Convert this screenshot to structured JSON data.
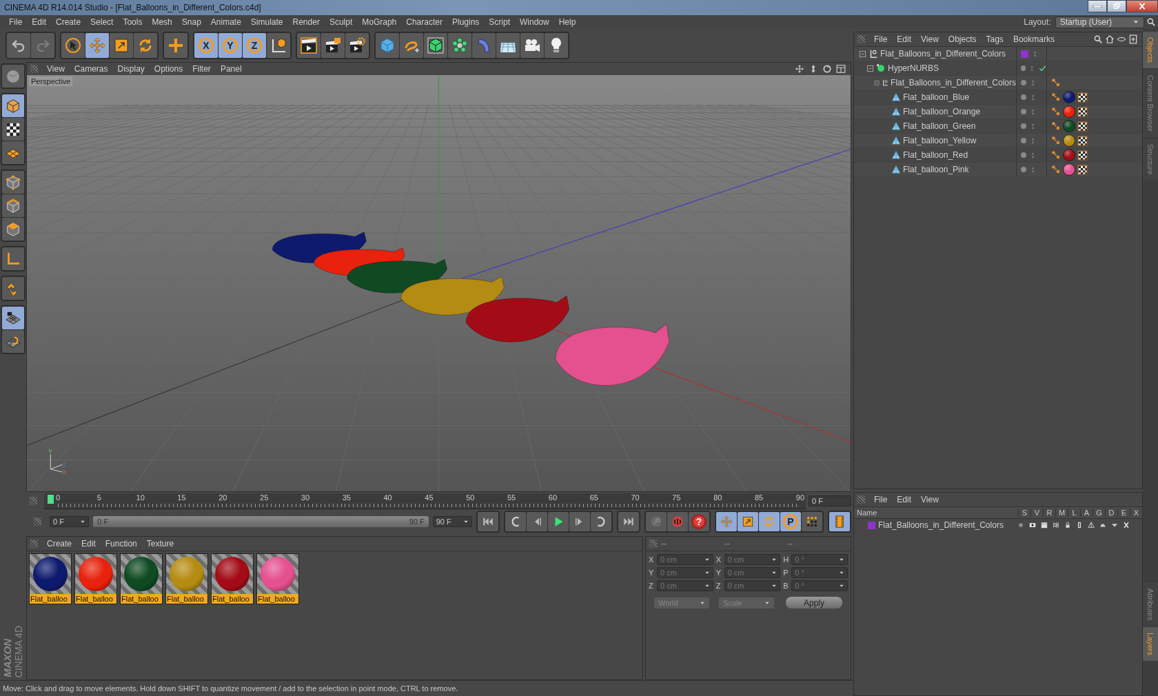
{
  "window": {
    "title": "CINEMA 4D R14.014 Studio - [Flat_Balloons_in_Different_Colors.c4d]"
  },
  "menu": [
    "File",
    "Edit",
    "Create",
    "Select",
    "Tools",
    "Mesh",
    "Snap",
    "Animate",
    "Simulate",
    "Render",
    "Sculpt",
    "MoGraph",
    "Character",
    "Plugins",
    "Script",
    "Window",
    "Help"
  ],
  "layout": {
    "label": "Layout:",
    "value": "Startup (User)"
  },
  "toolbar": {
    "groups": [
      {
        "items": [
          {
            "kind": "undo",
            "selected": false,
            "disabled": false
          },
          {
            "kind": "redo",
            "selected": false,
            "disabled": true
          }
        ]
      },
      {
        "items": [
          {
            "kind": "select",
            "selected": false,
            "disabled": false
          },
          {
            "kind": "move",
            "selected": true,
            "disabled": false
          },
          {
            "kind": "scale",
            "selected": false,
            "disabled": false
          },
          {
            "kind": "rotate",
            "selected": false,
            "disabled": false
          }
        ]
      },
      {
        "items": [
          {
            "kind": "add",
            "selected": false,
            "disabled": false
          }
        ]
      },
      {
        "items": [
          {
            "kind": "axis",
            "label": "X",
            "selected": true,
            "disabled": false
          },
          {
            "kind": "axis",
            "label": "Y",
            "selected": true,
            "disabled": false
          },
          {
            "kind": "axis",
            "label": "Z",
            "selected": true,
            "disabled": false
          },
          {
            "kind": "coords",
            "selected": false,
            "disabled": false
          }
        ]
      },
      {
        "items": [
          {
            "kind": "render-view",
            "selected": false,
            "disabled": false
          },
          {
            "kind": "render",
            "selected": false,
            "disabled": false
          },
          {
            "kind": "render-settings",
            "selected": false,
            "disabled": false
          }
        ]
      },
      {
        "items": [
          {
            "kind": "cube",
            "selected": false,
            "disabled": false
          },
          {
            "kind": "spline",
            "selected": false,
            "disabled": false
          },
          {
            "kind": "nurbs",
            "selected": false,
            "disabled": false
          },
          {
            "kind": "array",
            "selected": false,
            "disabled": false
          },
          {
            "kind": "deformer",
            "selected": false,
            "disabled": false
          },
          {
            "kind": "floor",
            "selected": false,
            "disabled": false
          },
          {
            "kind": "camera",
            "selected": false,
            "disabled": false
          },
          {
            "kind": "light",
            "selected": false,
            "disabled": false
          }
        ]
      }
    ]
  },
  "left_tools": {
    "groups": [
      {
        "items": [
          {
            "kind": "sculpt",
            "selected": false,
            "disabled": false
          }
        ]
      },
      {
        "items": [
          {
            "kind": "model",
            "selected": true,
            "disabled": false
          },
          {
            "kind": "texture",
            "selected": false,
            "disabled": false
          },
          {
            "kind": "workplane",
            "selected": false,
            "disabled": false
          }
        ]
      },
      {
        "items": [
          {
            "kind": "points",
            "selected": false,
            "disabled": false
          },
          {
            "kind": "edges",
            "selected": false,
            "disabled": false
          },
          {
            "kind": "polygons",
            "selected": false,
            "disabled": false
          }
        ]
      },
      {
        "items": [
          {
            "kind": "axis-mode",
            "selected": false,
            "disabled": false
          }
        ]
      },
      {
        "items": [
          {
            "kind": "magnet",
            "selected": false,
            "disabled": false
          }
        ]
      },
      {
        "items": [
          {
            "kind": "grid-lock",
            "selected": true,
            "disabled": false
          },
          {
            "kind": "grid-snap",
            "selected": false,
            "disabled": false
          }
        ]
      }
    ]
  },
  "logo": {
    "brand": "MAXON",
    "product": "CINEMA 4D"
  },
  "viewport": {
    "menu": [
      "View",
      "Cameras",
      "Display",
      "Options",
      "Filter",
      "Panel"
    ],
    "camera": "Perspective",
    "gizmo_labels": [
      "Y",
      "Z",
      "X"
    ]
  },
  "timeline": {
    "ticks": [
      "0",
      "5",
      "10",
      "15",
      "20",
      "25",
      "30",
      "35",
      "40",
      "45",
      "50",
      "55",
      "60",
      "65",
      "70",
      "75",
      "80",
      "85",
      "90"
    ],
    "level": 0,
    "current_frame": "0 F",
    "start": "0 F",
    "range": {
      "start": "0 F",
      "end": "90 F",
      "level": 1
    },
    "end": "90 F",
    "controls": {
      "groups": [
        {
          "items": [
            {
              "kind": "first",
              "selected": false,
              "disabled": false
            }
          ]
        },
        {
          "items": [
            {
              "kind": "prev-key",
              "selected": false,
              "disabled": false
            },
            {
              "kind": "prev-frame",
              "selected": false,
              "disabled": false
            },
            {
              "kind": "play",
              "selected": false,
              "disabled": false
            },
            {
              "kind": "next-frame",
              "selected": false,
              "disabled": false
            },
            {
              "kind": "next-key",
              "selected": false,
              "disabled": false
            }
          ]
        },
        {
          "items": [
            {
              "kind": "last",
              "selected": false,
              "disabled": false
            }
          ]
        },
        {
          "items": [
            {
              "kind": "keyframe",
              "selected": false,
              "disabled": true
            },
            {
              "kind": "autokey",
              "selected": false,
              "disabled": false
            },
            {
              "kind": "help",
              "label": "?",
              "selected": false,
              "disabled": false
            }
          ]
        },
        {
          "items": [
            {
              "kind": "move",
              "selected": true,
              "disabled": false
            },
            {
              "kind": "scale",
              "selected": true,
              "disabled": false
            },
            {
              "kind": "rotate",
              "selected": true,
              "disabled": false
            },
            {
              "kind": "param",
              "label": "P",
              "selected": true,
              "disabled": false
            },
            {
              "kind": "dots",
              "selected": false,
              "disabled": false
            }
          ]
        },
        {
          "items": [
            {
              "kind": "film",
              "selected": true,
              "disabled": false
            }
          ]
        }
      ]
    }
  },
  "materials": {
    "menu": [
      "Create",
      "Edit",
      "Function",
      "Texture"
    ],
    "items": [
      {
        "name": "Flat_balloo",
        "color": "#0e1a6e"
      },
      {
        "name": "Flat_balloo",
        "color": "#e8220c"
      },
      {
        "name": "Flat_balloo",
        "color": "#0f4a22"
      },
      {
        "name": "Flat_balloo",
        "color": "#b58c12"
      },
      {
        "name": "Flat_balloo",
        "color": "#a30c16"
      },
      {
        "name": "Flat_balloo",
        "color": "#e5508f"
      }
    ]
  },
  "coordinates": {
    "headers": [
      "--",
      "--",
      "--"
    ],
    "rows": [
      {
        "cells": [
          {
            "label": "X",
            "value": "0 cm"
          },
          {
            "label": "X",
            "value": "0 cm"
          },
          {
            "label": "H",
            "value": "0 °"
          }
        ]
      },
      {
        "cells": [
          {
            "label": "Y",
            "value": "0 cm"
          },
          {
            "label": "Y",
            "value": "0 cm"
          },
          {
            "label": "P",
            "value": "0 °"
          }
        ]
      },
      {
        "cells": [
          {
            "label": "Z",
            "value": "0 cm"
          },
          {
            "label": "Z",
            "value": "0 cm"
          },
          {
            "label": "B",
            "value": "0 °"
          }
        ]
      }
    ],
    "space": "World",
    "mode": "Scale",
    "apply": "Apply"
  },
  "objects": {
    "menu": [
      "File",
      "Edit",
      "View",
      "Objects",
      "Tags",
      "Bookmarks"
    ],
    "tree": [
      {
        "name": "Flat_Balloons_in_Different_Colors",
        "kind": "null",
        "expanded": true,
        "color": "#8e34c8",
        "enabled": false,
        "children": [
          {
            "name": "HyperNURBS",
            "kind": "hypernurbs",
            "expanded": true,
            "enabled": true,
            "children": [
              {
                "name": "Flat_Balloons_in_Different_Colors",
                "kind": "null",
                "expanded": true,
                "enabled": false,
                "tags": [
                  {
                    "kind": "phong"
                  }
                ],
                "children": [
                  {
                    "name": "Flat_balloon_Blue",
                    "kind": "polygon",
                    "enabled": false,
                    "tags": [
                      {
                        "kind": "phong"
                      },
                      {
                        "kind": "material",
                        "color": "#0e1a6e"
                      },
                      {
                        "kind": "texture"
                      }
                    ]
                  },
                  {
                    "name": "Flat_balloon_Orange",
                    "kind": "polygon",
                    "enabled": false,
                    "tags": [
                      {
                        "kind": "phong"
                      },
                      {
                        "kind": "material",
                        "color": "#e8220c"
                      },
                      {
                        "kind": "texture"
                      }
                    ]
                  },
                  {
                    "name": "Flat_balloon_Green",
                    "kind": "polygon",
                    "enabled": false,
                    "tags": [
                      {
                        "kind": "phong"
                      },
                      {
                        "kind": "material",
                        "color": "#0f4a22"
                      },
                      {
                        "kind": "texture"
                      }
                    ]
                  },
                  {
                    "name": "Flat_balloon_Yellow",
                    "kind": "polygon",
                    "enabled": false,
                    "tags": [
                      {
                        "kind": "phong"
                      },
                      {
                        "kind": "material",
                        "color": "#b58c12"
                      },
                      {
                        "kind": "texture"
                      }
                    ]
                  },
                  {
                    "name": "Flat_balloon_Red",
                    "kind": "polygon",
                    "enabled": false,
                    "tags": [
                      {
                        "kind": "phong"
                      },
                      {
                        "kind": "material",
                        "color": "#a30c16"
                      },
                      {
                        "kind": "texture"
                      }
                    ]
                  },
                  {
                    "name": "Flat_balloon_Pink",
                    "kind": "polygon",
                    "enabled": false,
                    "tags": [
                      {
                        "kind": "phong"
                      },
                      {
                        "kind": "material",
                        "color": "#e5508f"
                      },
                      {
                        "kind": "texture"
                      }
                    ]
                  }
                ]
              }
            ]
          }
        ]
      }
    ]
  },
  "side_tabs_top": [
    {
      "label": "Objects",
      "selected": true
    },
    {
      "label": "Content Browser",
      "selected": false
    },
    {
      "label": "Structure",
      "selected": false
    }
  ],
  "side_tabs_bottom": [
    {
      "label": "Attributes",
      "selected": false
    },
    {
      "label": "Layers",
      "selected": true
    }
  ],
  "layers": {
    "menu": [
      "File",
      "Edit",
      "View"
    ],
    "columns": [
      "Name",
      "S",
      "V",
      "R",
      "M",
      "L",
      "A",
      "G",
      "D",
      "E",
      "X"
    ],
    "rows": [
      {
        "name": "Flat_Balloons_in_Different_Colors",
        "color": "#8e34c8"
      }
    ]
  },
  "status_bar": "Move: Click and drag to move elements. Hold down SHIFT to quantize movement / add to the selection in point mode, CTRL to remove."
}
